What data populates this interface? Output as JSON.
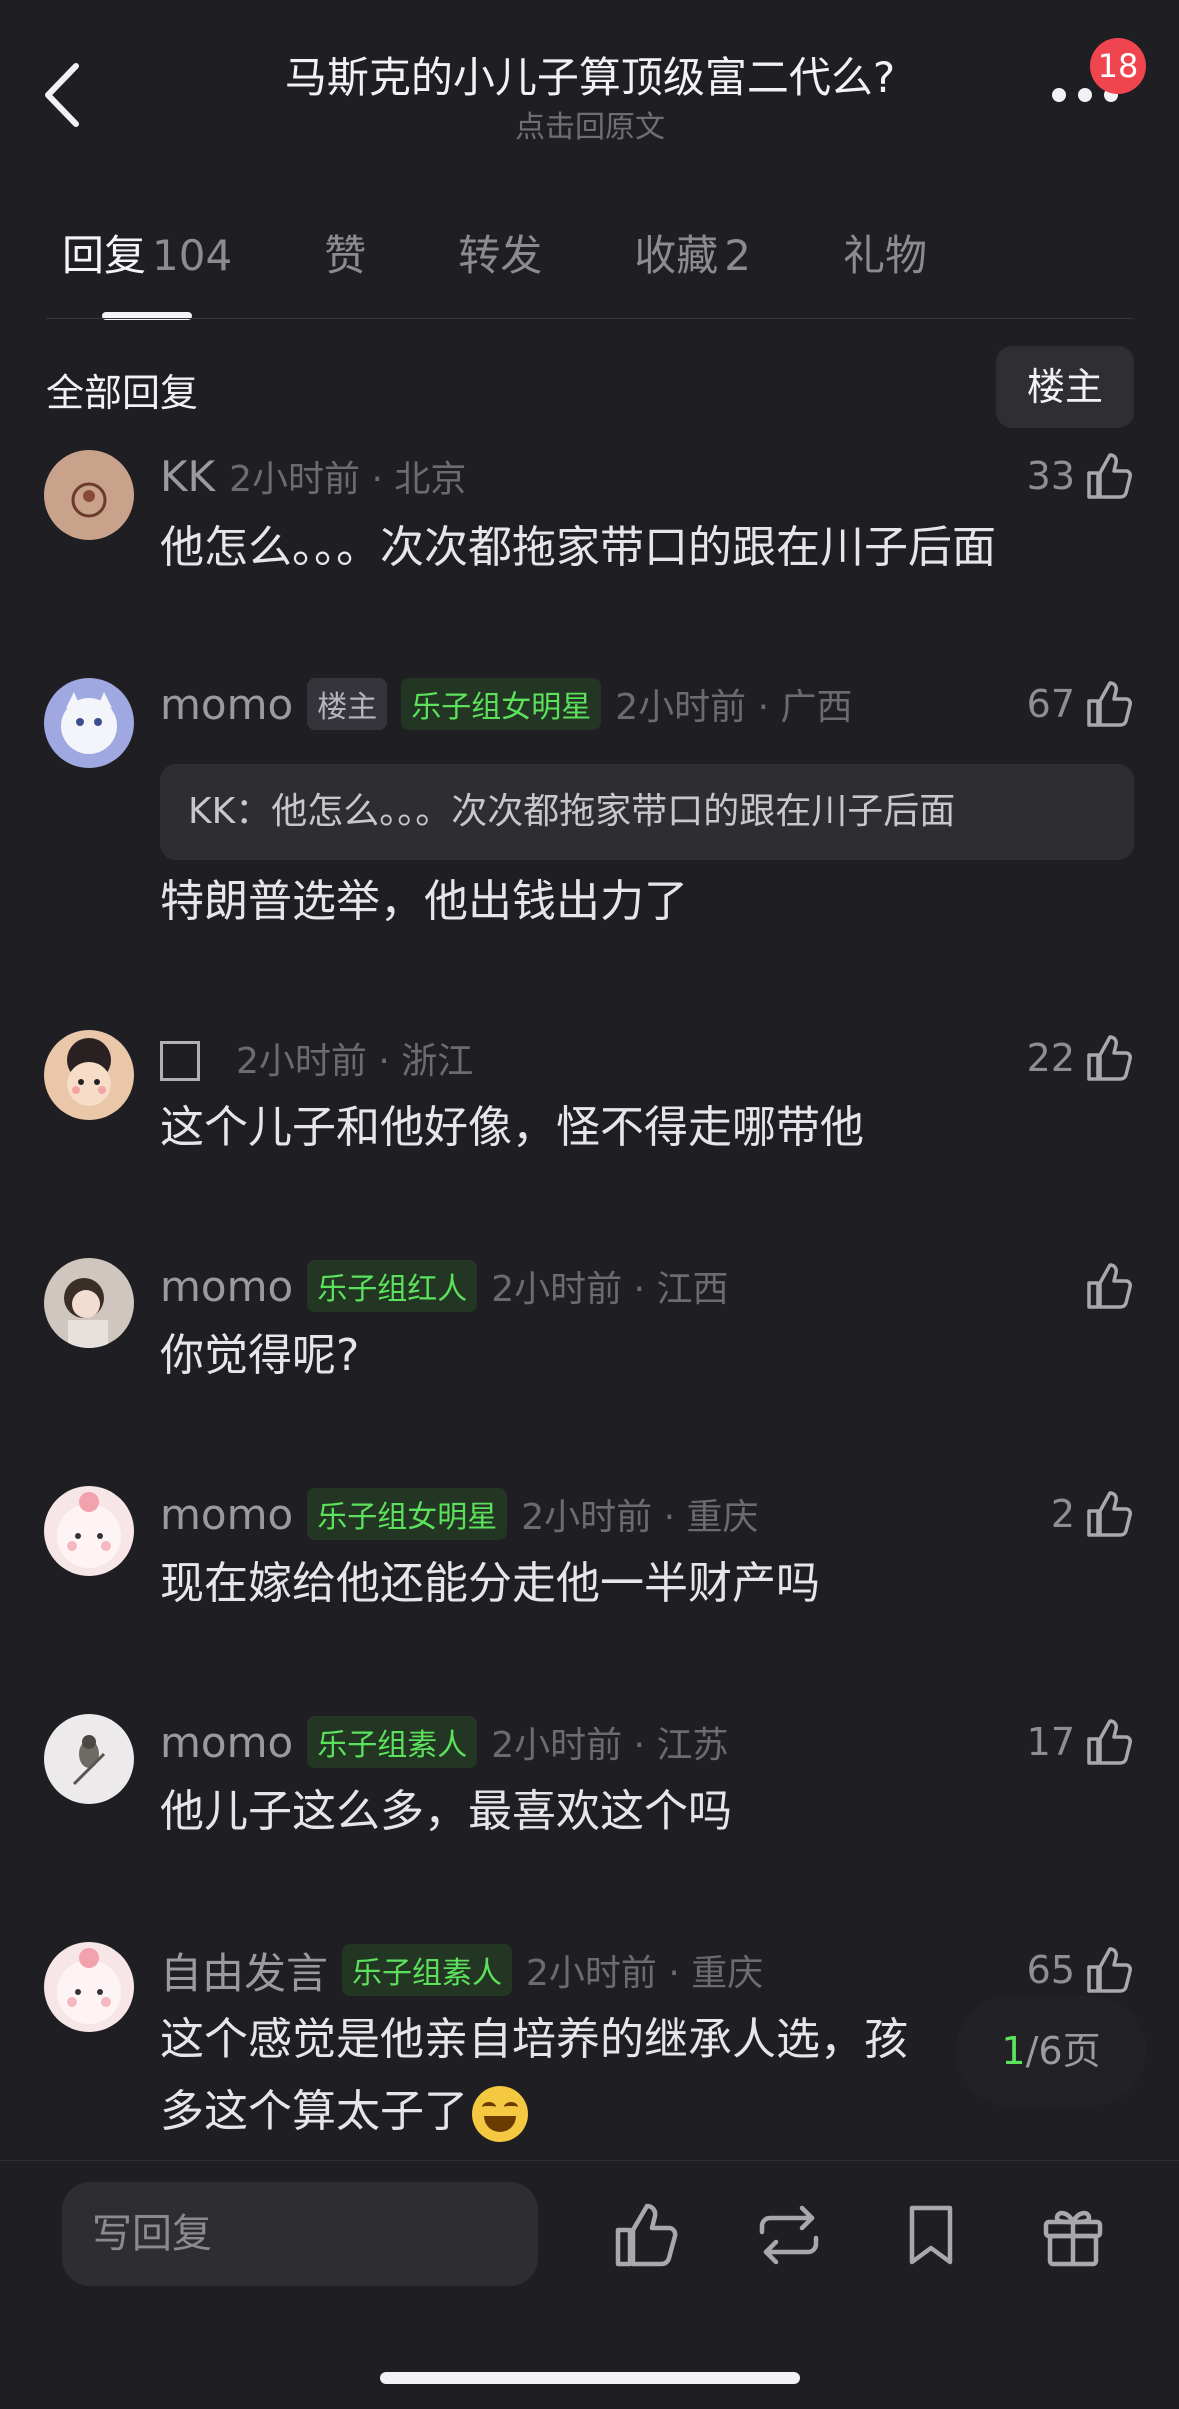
{
  "header": {
    "title": "马斯克的小儿子算顶级富二代么?",
    "subtitle": "点击回原文",
    "notification_count": "18"
  },
  "tabs": [
    {
      "label": "回复",
      "count": "104",
      "active": true
    },
    {
      "label": "赞",
      "count": ""
    },
    {
      "label": "转发",
      "count": ""
    },
    {
      "label": "收藏",
      "count": "2"
    },
    {
      "label": "礼物",
      "count": ""
    }
  ],
  "section": {
    "title": "全部回复",
    "owner_button": "楼主"
  },
  "comments": [
    {
      "name": "KK",
      "tags": [],
      "time": "2小时前 · 北京",
      "likes": "33",
      "text": "他怎么。。。次次都拖家带口的跟在川子后面"
    },
    {
      "name": "momo",
      "owner_tag": "楼主",
      "tags": [
        "乐子组女明星"
      ],
      "time": "2小时前 · 广西",
      "likes": "67",
      "quote": "KK：他怎么。。。次次都拖家带口的跟在川子后面",
      "text": "特朗普选举，他出钱出力了"
    },
    {
      "name": "",
      "tags": [],
      "time": "2小时前 · 浙江",
      "likes": "22",
      "text": "这个儿子和他好像，怪不得走哪带他"
    },
    {
      "name": "momo",
      "tags": [
        "乐子组红人"
      ],
      "time": "2小时前 · 江西",
      "likes": "",
      "text": "你觉得呢?"
    },
    {
      "name": "momo",
      "tags": [
        "乐子组女明星"
      ],
      "time": "2小时前 · 重庆",
      "likes": "2",
      "text": "现在嫁给他还能分走他一半财产吗"
    },
    {
      "name": "momo",
      "tags": [
        "乐子组素人"
      ],
      "time": "2小时前 · 江苏",
      "likes": "17",
      "text": "他儿子这么多，最喜欢这个吗"
    },
    {
      "name": "自由发言",
      "tags": [
        "乐子组素人"
      ],
      "time": "2小时前 · 重庆",
      "likes": "65",
      "text": "这个感觉是他亲自培养的继承人选，孩",
      "text2": "多这个算太子了"
    }
  ],
  "pagination": {
    "current": "1",
    "total": "/6页"
  },
  "bottom": {
    "reply_placeholder": "写回复"
  },
  "icons": [
    "back-icon",
    "more-icon",
    "thumbs-up-icon",
    "repost-icon",
    "bookmark-icon",
    "gift-icon",
    "laughing-emoji-icon"
  ]
}
